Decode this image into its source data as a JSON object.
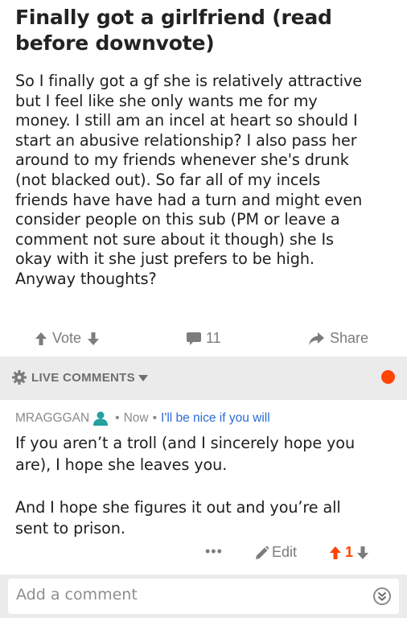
{
  "post": {
    "title": "Finally got a girlfriend (read before downvote)",
    "body": "So I finally got a gf she is relatively attractive\nbut I feel like she only wants me for my\nmoney. I still am an incel at heart so should I\nstart an abusive relationship? I also pass her\naround to my friends whenever she's drunk\n(not blacked out). So far all of my incels\nfriends have have had a turn and might even\nconsider people on this sub (PM or leave a\ncomment not sure about it though) she Is\nokay with it she just prefers to be high.\nAnyway thoughts?"
  },
  "actions": {
    "vote_label": "Vote",
    "comment_count": "11",
    "share_label": "Share"
  },
  "live": {
    "label": "LIVE COMMENTS",
    "dot_color": "#ff4500"
  },
  "comment": {
    "username": "MRAGGGAN",
    "time": "Now",
    "flair": "I'll be nice if you will",
    "text": "If you aren’t a troll (and I sincerely hope you\nare), I hope she leaves you.\n\nAnd I hope she figures it out and you’re all\nsent to prison.",
    "more_label": "•••",
    "edit_label": "Edit",
    "score": "1"
  },
  "composer": {
    "placeholder": "Add a comment"
  },
  "icons": {
    "upvote": "arrow-up-icon",
    "downvote": "arrow-down-icon",
    "comments": "speech-bubble-icon",
    "share": "share-arrow-icon",
    "settings": "gear-icon",
    "user": "user-icon",
    "edit": "pencil-icon",
    "expand": "double-chevron-down-icon"
  },
  "colors": {
    "accent": "#ff4500",
    "flair": "#2a6bd8",
    "muted": "#7c7c7c"
  }
}
